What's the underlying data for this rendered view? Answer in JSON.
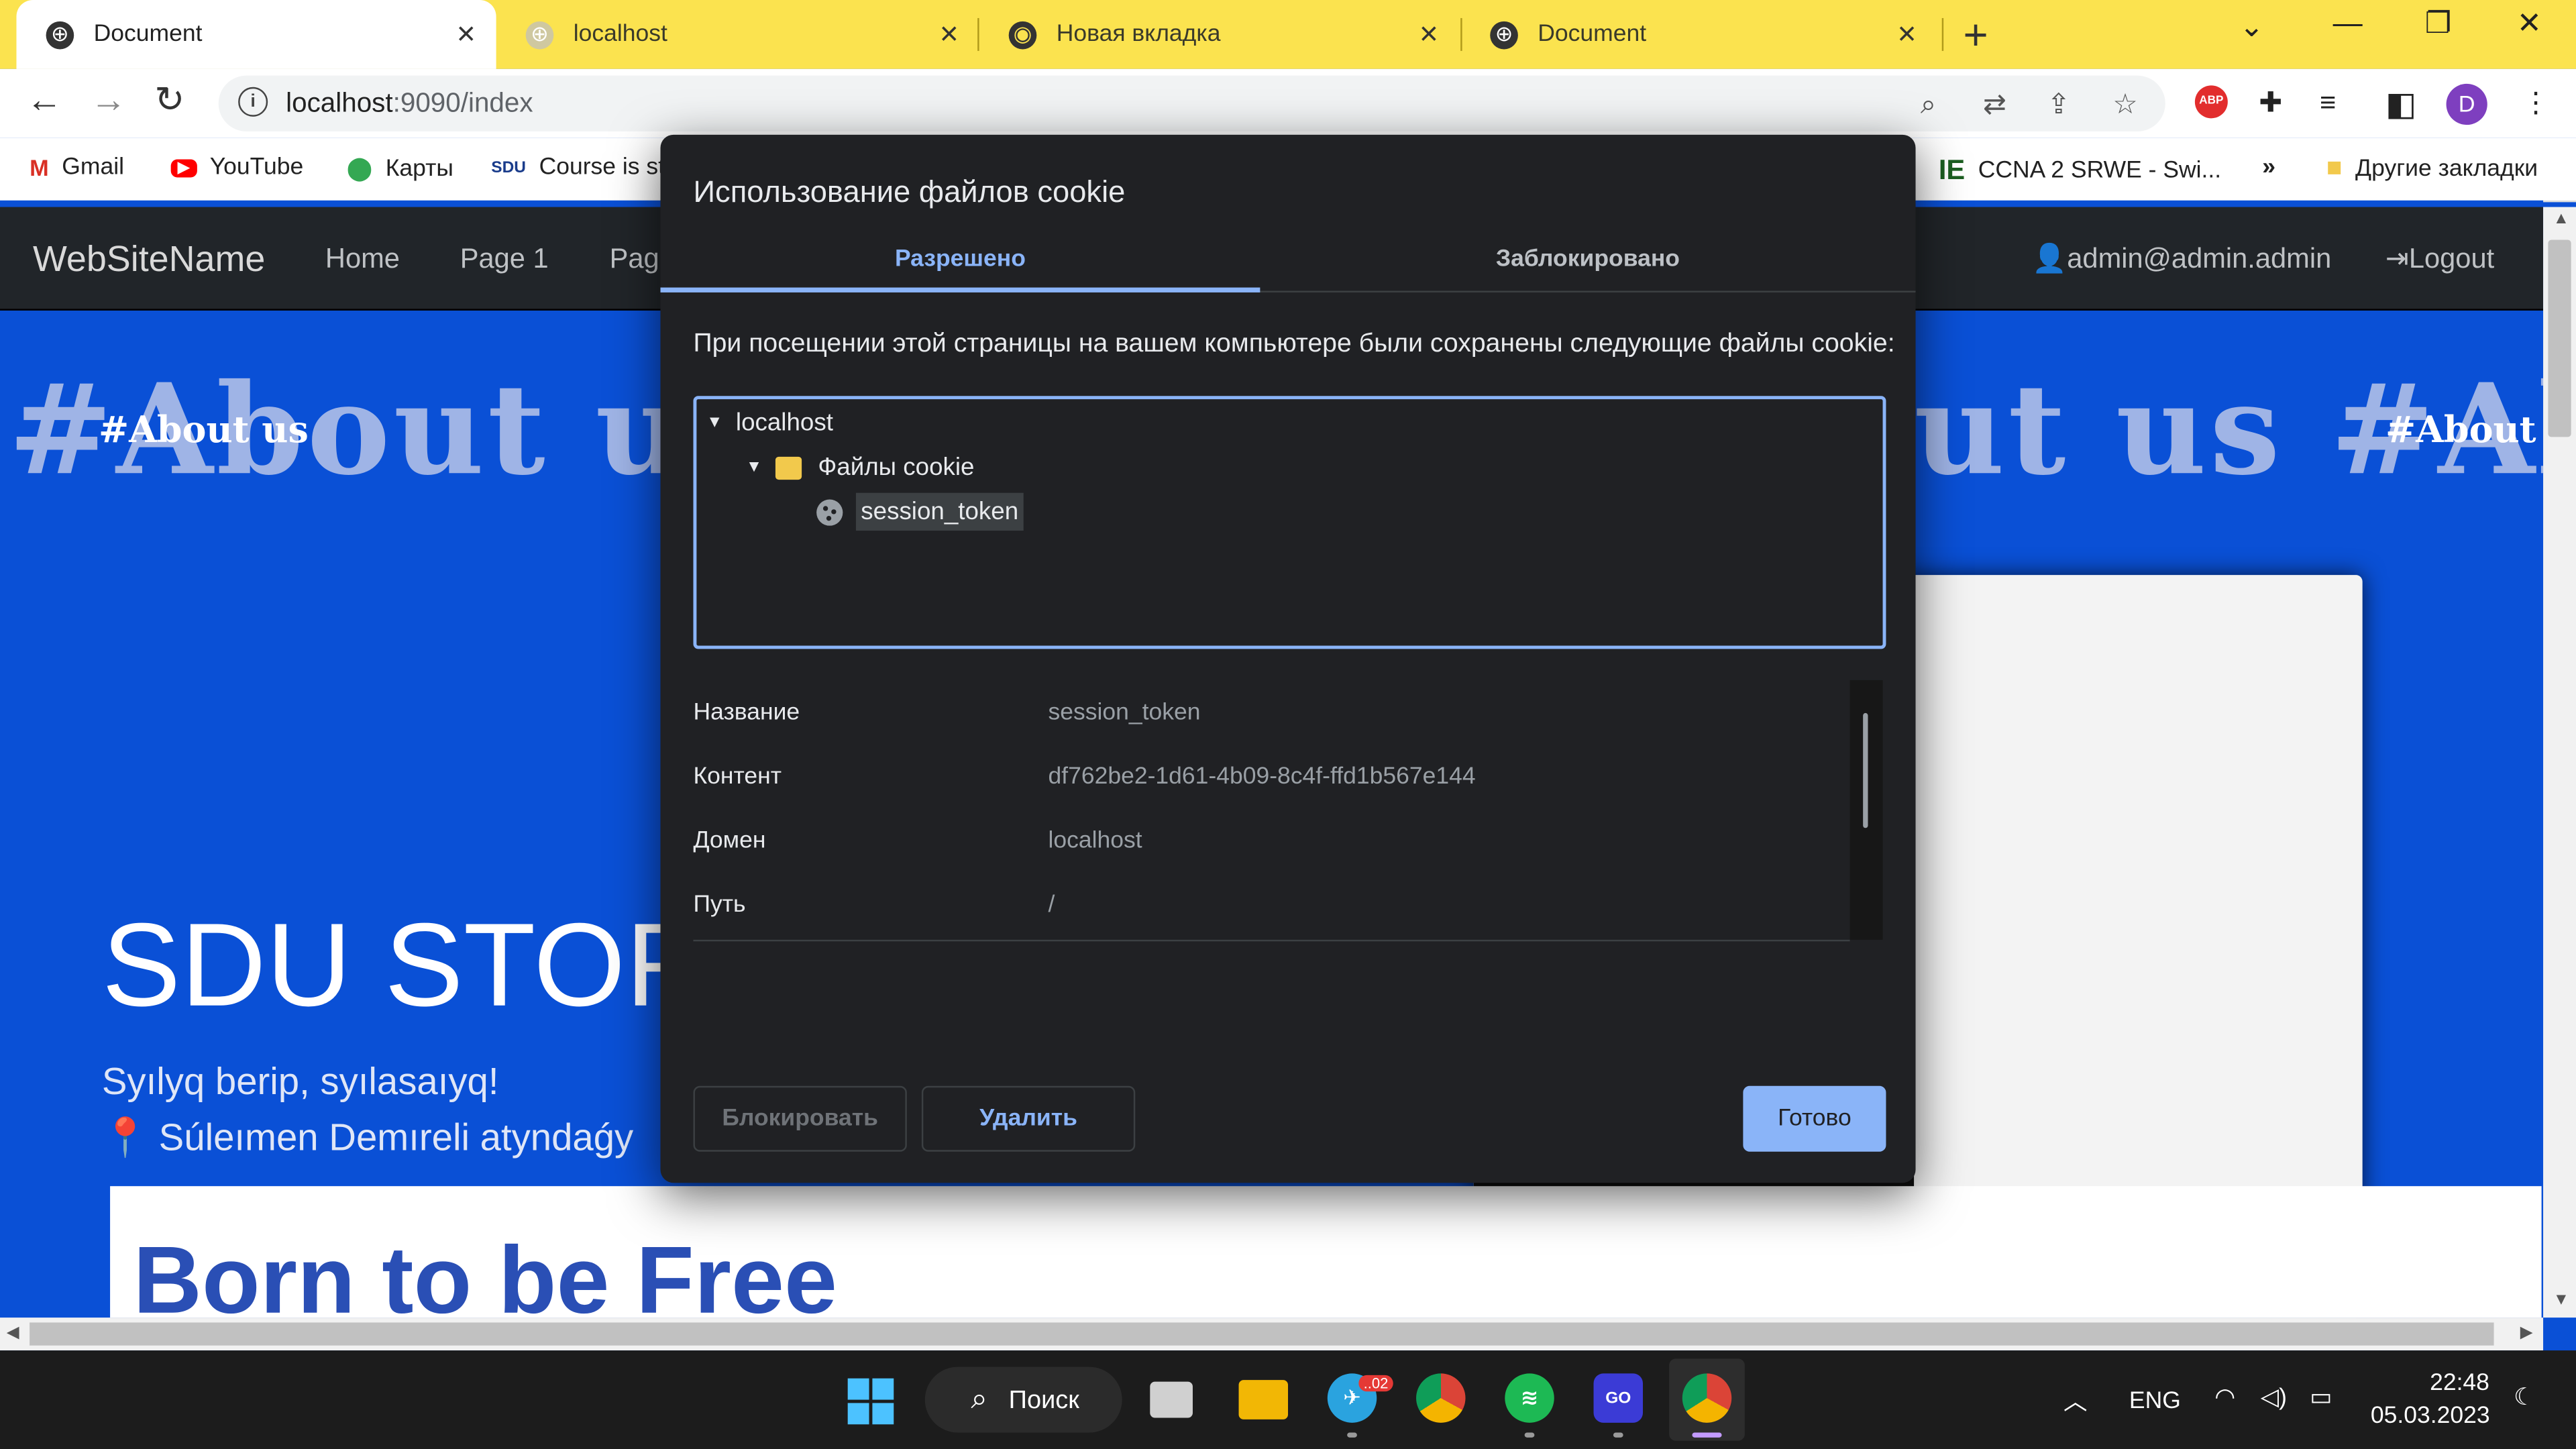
{
  "browser": {
    "tabs": [
      {
        "title": "Document",
        "active": true
      },
      {
        "title": "localhost",
        "active": false
      },
      {
        "title": "Новая вкладка",
        "active": false
      },
      {
        "title": "Document",
        "active": false
      }
    ],
    "address": {
      "host": "localhost",
      "path": ":9090/index"
    },
    "profile_initial": "D",
    "bookmarks": [
      {
        "label": "Gmail",
        "icon": "gmail-icon"
      },
      {
        "label": "YouTube",
        "icon": "youtube-icon"
      },
      {
        "label": "Карты",
        "icon": "maps-icon"
      },
      {
        "label": "Course is st",
        "icon": "sdu-moodle-icon"
      },
      {
        "label": "CCNA 2 SRWE - Swi...",
        "icon": "ie-icon"
      },
      {
        "label": "»",
        "icon": "chevrons-right-icon"
      },
      {
        "label": "Другие закладки",
        "icon": "folder-icon"
      }
    ],
    "abp_label": "ABP"
  },
  "site": {
    "brand": "WebSiteName",
    "nav": [
      "Home",
      "Page 1",
      "Pag"
    ],
    "user": "admin@admin.admin",
    "logout": "Logout",
    "marquee_big_left": "#About us",
    "marquee_big_right": "ut us #Ab",
    "marquee_small": "#About us",
    "hero_title": "SDU STOR",
    "hero_subtitle": "Syılyq berip, syılasaıyq!",
    "hero_location": "Súleımen Demıreli atyndaǵy",
    "card_heading": "Born to be Free"
  },
  "dialog": {
    "title": "Использование файлов cookie",
    "tab_allowed": "Разрешено",
    "tab_blocked": "Заблокировано",
    "description": "При посещении этой страницы на вашем компьютере были сохранены следующие файлы cookie:",
    "tree": {
      "host": "localhost",
      "folder": "Файлы cookie",
      "cookie": "session_token"
    },
    "details": [
      {
        "label": "Название",
        "value": "session_token"
      },
      {
        "label": "Контент",
        "value": "df762be2-1d61-4b09-8c4f-ffd1b567e144"
      },
      {
        "label": "Домен",
        "value": "localhost"
      },
      {
        "label": "Путь",
        "value": "/"
      }
    ],
    "btn_block": "Блокировать",
    "btn_delete": "Удалить",
    "btn_done": "Готово"
  },
  "taskbar": {
    "search": "Поиск",
    "telegram_badge": "..02",
    "go_label": "GO",
    "lang": "ENG",
    "time": "22:48",
    "date": "05.03.2023"
  },
  "colors": {
    "tabstrip": "#fbe34f",
    "page_blue": "#0a50d6",
    "dialog_bg": "#202124",
    "accent": "#8ab4f8"
  }
}
